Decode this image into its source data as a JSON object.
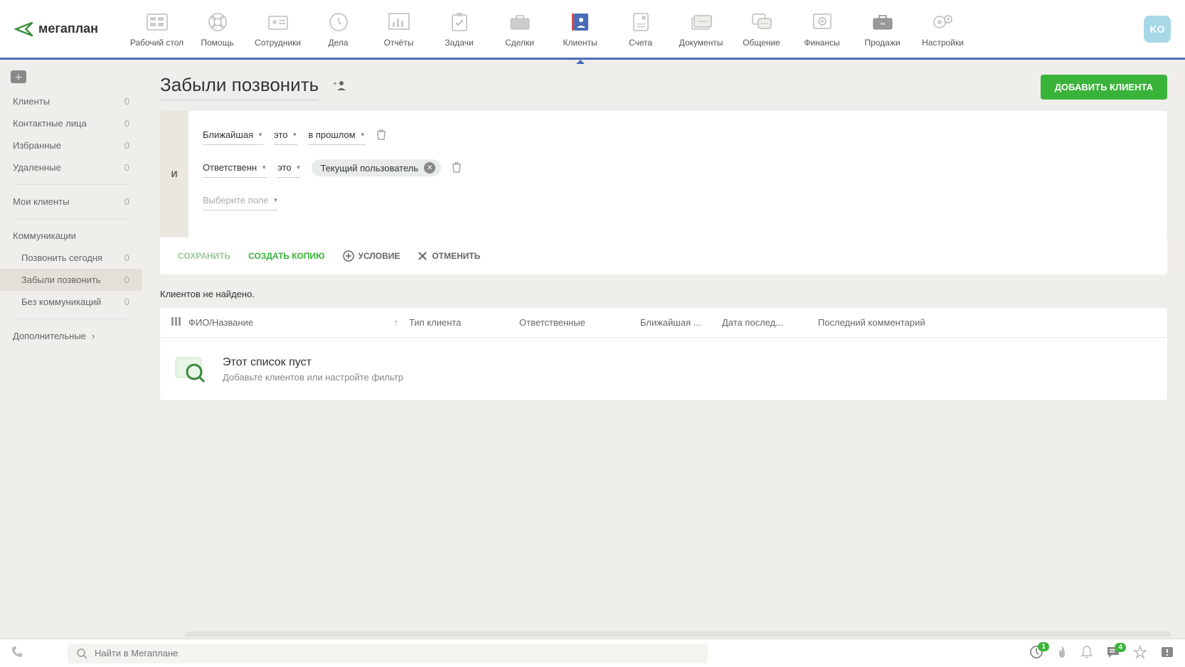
{
  "logo": "мегаплан",
  "nav": [
    {
      "label": "Рабочий стол"
    },
    {
      "label": "Помощь"
    },
    {
      "label": "Сотрудники"
    },
    {
      "label": "Дела"
    },
    {
      "label": "Отчёты"
    },
    {
      "label": "Задачи"
    },
    {
      "label": "Сделки"
    },
    {
      "label": "Клиенты"
    },
    {
      "label": "Счета"
    },
    {
      "label": "Документы"
    },
    {
      "label": "Общение"
    },
    {
      "label": "Финансы"
    },
    {
      "label": "Продажи"
    },
    {
      "label": "Настройки"
    }
  ],
  "avatar": "KO",
  "sidebar": {
    "groups": [
      [
        {
          "label": "Клиенты",
          "count": "0"
        },
        {
          "label": "Контактные лица",
          "count": "0"
        },
        {
          "label": "Избранные",
          "count": "0"
        },
        {
          "label": "Удаленные",
          "count": "0"
        }
      ],
      [
        {
          "label": "Мои клиенты",
          "count": "0"
        }
      ],
      [
        {
          "label": "Коммуникации",
          "count": ""
        },
        {
          "label": "Позвонить сегодня",
          "count": "0",
          "indent": true
        },
        {
          "label": "Забыли позвонить",
          "count": "0",
          "indent": true,
          "active": true
        },
        {
          "label": "Без коммуникаций",
          "count": "0",
          "indent": true
        }
      ]
    ],
    "expand": "Дополнительные"
  },
  "page": {
    "title": "Забыли позвонить",
    "add_client": "ДОБАВИТЬ КЛИЕНТА"
  },
  "filter": {
    "and": "И",
    "rows": [
      {
        "field": "Ближайшая",
        "op": "это",
        "value": "в прошлом"
      },
      {
        "field": "Ответственн",
        "op": "это",
        "tag": "Текущий пользователь"
      }
    ],
    "placeholder": "Выберите поле",
    "actions": {
      "save": "СОХРАНИТЬ",
      "copy": "СОЗДАТЬ КОПИЮ",
      "condition": "УСЛОВИЕ",
      "cancel": "ОТМЕНИТЬ"
    }
  },
  "results": {
    "none": "Клиентов не найдено.",
    "columns": {
      "name": "ФИО/Название",
      "type": "Тип клиента",
      "responsible": "Ответственные",
      "nearest": "Ближайшая ...",
      "last_date": "Дата послед...",
      "last_comment": "Последний комментарий"
    },
    "empty": {
      "title": "Этот список пуст",
      "sub": "Добавьте клиентов или настройте фильтр"
    }
  },
  "bottombar": {
    "search_placeholder": "Найти в Мегаплане",
    "badge1": "1",
    "badge2": "4"
  }
}
